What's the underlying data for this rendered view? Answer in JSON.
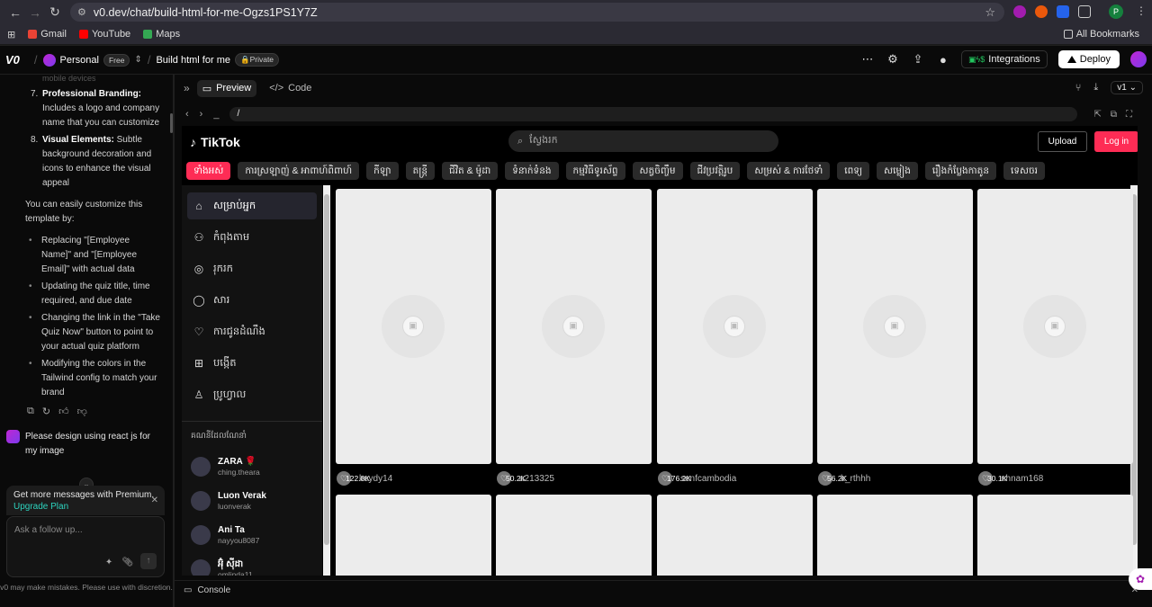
{
  "browser": {
    "url": "v0.dev/chat/build-html-for-me-Ogzs1PS1Y7Z",
    "bookmarks": [
      "Gmail",
      "YouTube",
      "Maps"
    ],
    "all_bookmarks": "All Bookmarks",
    "profile_initial": "P"
  },
  "v0": {
    "logo": "V0",
    "workspace": "Personal",
    "plan": "Free",
    "project": "Build html for me",
    "visibility": "Private",
    "integrations": "Integrations",
    "deploy": "Deploy"
  },
  "chat": {
    "faded_top": "mobile devices",
    "items": [
      {
        "n": "7.",
        "title": "Professional Branding:",
        "text": "Includes a logo and company name that you can customize"
      },
      {
        "n": "8.",
        "title": "Visual Elements:",
        "text": "Subtle background decoration and icons to enhance the visual appeal"
      }
    ],
    "intro": "You can easily customize this template by:",
    "bullets": [
      "Replacing \"[Employee Name]\" and \"[Employee Email]\" with actual data",
      "Updating the quiz title, time required, and due date",
      "Changing the link in the \"Take Quiz Now\" button to point to your actual quiz platform",
      "Modifying the colors in the Tailwind config to match your brand"
    ],
    "user_message": "Please design using react js for my image",
    "premium_text": "Get more messages with Premium.",
    "upgrade": "Upgrade Plan",
    "ask_placeholder": "Ask a follow up...",
    "disclaimer": "v0 may make mistakes. Please use with discretion."
  },
  "preview": {
    "tab_preview": "Preview",
    "tab_code": "Code",
    "version": "v1",
    "path": "/",
    "console": "Console"
  },
  "tiktok": {
    "brand": "TikTok",
    "search_placeholder": "ស្វែងរក",
    "upload": "Upload",
    "login": "Log in",
    "categories": [
      "ទាំងអស់",
      "ការស្រឡាញ់ & អាពាហ៍ពិពាហ៍",
      "កីឡា",
      "តន្ត្រី",
      "ជីវិត & ម៉ូដា",
      "ទំនាក់ទំនង",
      "កម្មវិធីទូរស័ព្ទ",
      "សត្វចិញ្ចឹម",
      "ជីវប្រវត្តិរូប",
      "សម្រស់ & ការថែទាំ",
      "ពេទ្យ",
      "សម្លៀង",
      "រឿងកំប្លែងកាតូន",
      "ទេសចរ"
    ],
    "nav": [
      {
        "icon": "⌂",
        "label": "សម្រាប់អ្នក"
      },
      {
        "icon": "⚇",
        "label": "កំពុងតាម"
      },
      {
        "icon": "◎",
        "label": "រុករក"
      },
      {
        "icon": "◯",
        "label": "សារ"
      },
      {
        "icon": "♡",
        "label": "ការជូនដំណឹង"
      },
      {
        "icon": "⊞",
        "label": "បង្កើត"
      },
      {
        "icon": "♙",
        "label": "ប្រូហ្វាល"
      }
    ],
    "suggested_title": "គណនីដែលណែនាំ",
    "accounts": [
      {
        "name": "ZARA 🌹",
        "handle": "ching.theara"
      },
      {
        "name": "Luon Verak",
        "handle": "luonverak"
      },
      {
        "name": "Ani Ta",
        "handle": "nayyou8087"
      },
      {
        "name": "អ៊ុំ ស៊ីដា",
        "handle": "omlinda11"
      }
    ],
    "videos": [
      {
        "count": "122.8K",
        "user": "keydy14"
      },
      {
        "count": "50.2K",
        "user": "a213325"
      },
      {
        "count": "176.2K",
        "user": "senfcambodia"
      },
      {
        "count": "56.2K",
        "user": "k_rthhh"
      },
      {
        "count": "30.1K",
        "user": "nhnam168"
      }
    ]
  }
}
